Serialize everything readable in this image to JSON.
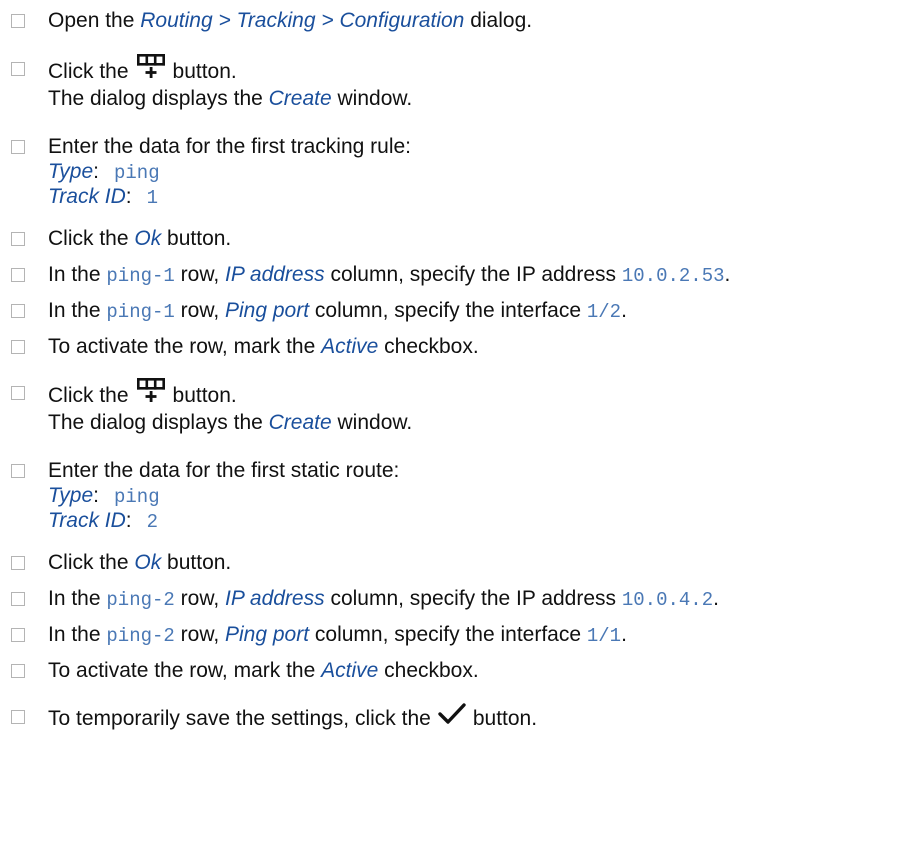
{
  "accent_color": "#1a4f9c",
  "value_color": "#4a78b5",
  "steps": [
    {
      "pre": "Open the ",
      "em": "Routing > Tracking > Configuration",
      "post": " dialog."
    },
    {
      "pre": "Click the",
      "icon": "add-row-icon",
      "post": "button.",
      "sub_pre": "The dialog displays the ",
      "sub_em": "Create",
      "sub_post": " window."
    },
    {
      "text": "Enter the data for the first tracking rule:",
      "fields": [
        {
          "label": "Type",
          "colon": ":",
          "value": "ping"
        },
        {
          "label": "Track ID",
          "colon": ":",
          "value": "1"
        }
      ]
    },
    {
      "pre": "Click the ",
      "em": "Ok",
      "post": " button."
    },
    {
      "pre": "In the ",
      "code": "ping-1",
      "mid": " row, ",
      "em": "IP address",
      "post": " column, specify the IP address ",
      "code2": "10.0.2.53",
      "end": "."
    },
    {
      "pre": "In the ",
      "code": "ping-1",
      "mid": " row, ",
      "em": "Ping port",
      "post": " column, specify the interface ",
      "code2": "1/2",
      "end": "."
    },
    {
      "pre": "To activate the row, mark the ",
      "em": "Active",
      "post": " checkbox."
    },
    {
      "pre": "Click the",
      "icon": "add-row-icon",
      "post": "button.",
      "sub_pre": "The dialog displays the ",
      "sub_em": "Create",
      "sub_post": " window."
    },
    {
      "text": "Enter the data for the first static route:",
      "fields": [
        {
          "label": "Type",
          "colon": ":",
          "value": "ping"
        },
        {
          "label": "Track ID",
          "colon": ":",
          "value": "2"
        }
      ]
    },
    {
      "pre": "Click the ",
      "em": "Ok",
      "post": " button."
    },
    {
      "pre": "In the ",
      "code": "ping-2",
      "mid": " row, ",
      "em": "IP address",
      "post": " column, specify the IP address ",
      "code2": "10.0.4.2",
      "end": "."
    },
    {
      "pre": "In the ",
      "code": "ping-2",
      "mid": " row, ",
      "em": "Ping port",
      "post": " column, specify the interface ",
      "code2": "1/1",
      "end": "."
    },
    {
      "pre": "To activate the row, mark the ",
      "em": "Active",
      "post": " checkbox."
    },
    {
      "pre": "To temporarily save the settings, click the",
      "icon": "checkmark-icon",
      "post": "button."
    }
  ]
}
